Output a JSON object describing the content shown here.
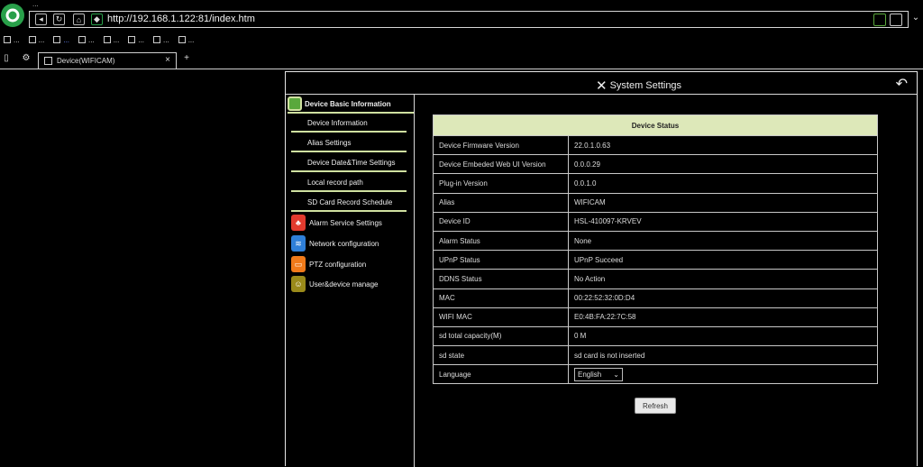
{
  "browser": {
    "window_title": "...",
    "url": "http://192.168.1.122:81/index.htm",
    "favorites": [
      "...",
      "...",
      "...",
      "...",
      "...",
      "...",
      "...",
      "..."
    ],
    "tab_title": "Device(WIFICAM)"
  },
  "header": {
    "title": "System Settings"
  },
  "sidebar": {
    "section_title": "Device Basic Information",
    "items": [
      "Device Information",
      "Alias Settings",
      "Device Date&Time Settings",
      "Local record path",
      "SD Card Record Schedule"
    ],
    "categories": [
      {
        "label": "Alarm Service Settings",
        "color": "#e23b2e"
      },
      {
        "label": "Network configuration",
        "color": "#2f7fd8"
      },
      {
        "label": "PTZ configuration",
        "color": "#f07a1a"
      },
      {
        "label": "User&device manage",
        "color": "#9a8a1a"
      }
    ]
  },
  "device_status": {
    "title": "Device Status",
    "rows": [
      {
        "label": "Device Firmware Version",
        "value": "22.0.1.0.63"
      },
      {
        "label": "Device Embeded Web UI Version",
        "value": "0.0.0.29"
      },
      {
        "label": "Plug-in Version",
        "value": "0.0.1.0"
      },
      {
        "label": "Alias",
        "value": "WIFICAM"
      },
      {
        "label": "Device ID",
        "value": "HSL-410097-KRVEV"
      },
      {
        "label": "Alarm Status",
        "value": "None"
      },
      {
        "label": "UPnP Status",
        "value": "UPnP Succeed"
      },
      {
        "label": "DDNS Status",
        "value": "No Action"
      },
      {
        "label": "MAC",
        "value": "00:22:52:32:0D:D4"
      },
      {
        "label": "WIFI MAC",
        "value": "E0:4B:FA:22:7C:58"
      },
      {
        "label": "sd total capacity(M)",
        "value": "0 M"
      },
      {
        "label": "sd state",
        "value": "sd card is not inserted"
      }
    ],
    "language_label": "Language",
    "language_value": "English"
  },
  "refresh_label": "Refresh",
  "colors": {
    "accent_green": "#dde8b9",
    "logo_green": "#5aa83c"
  }
}
